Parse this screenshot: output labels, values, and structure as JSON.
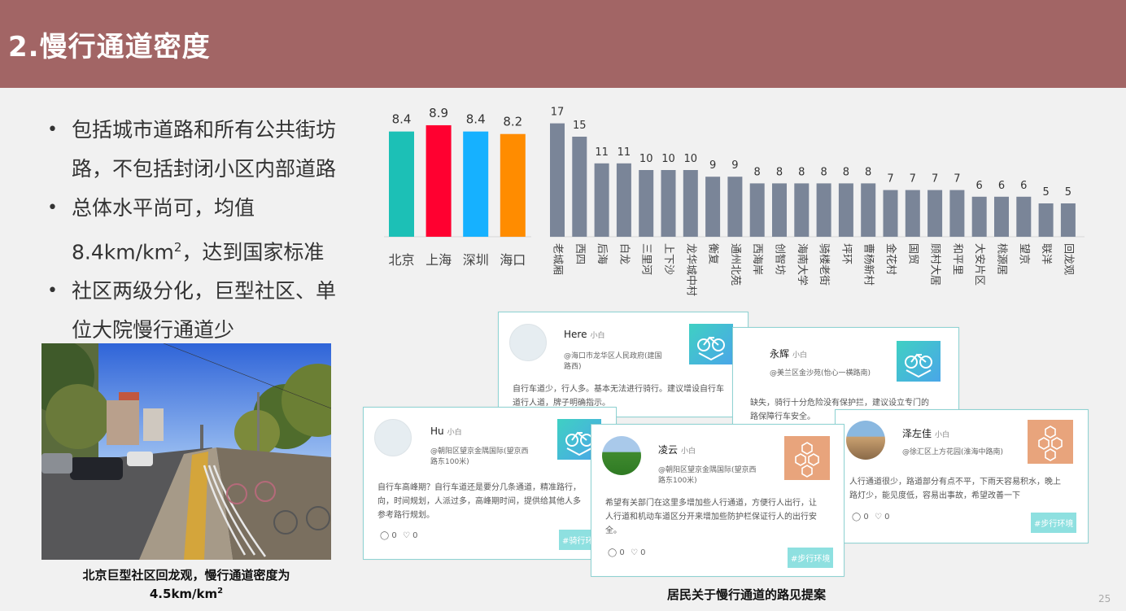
{
  "slide": {
    "title": "2.慢行通道密度",
    "bullets": [
      {
        "line1": "包括城市道路和所有公共街坊",
        "line2": "路，不包括封闭小区内部道路"
      },
      {
        "line1": "总体水平尚可，均值",
        "line2a": "8.4km/km",
        "line2sup": "2",
        "line2b": "，达到国家标准"
      },
      {
        "line1": "社区两级分化，巨型社区、单",
        "line2": "位大院慢行通道少"
      }
    ],
    "photo_caption": {
      "line1": "北京巨型社区回龙观，慢行通道密度为",
      "line2a": "4.5km/km",
      "line2sup": "2"
    },
    "cards_caption": "居民关于慢行通道的路见提案",
    "page_number": "25"
  },
  "chart_data": [
    {
      "type": "bar",
      "categories": [
        "北京",
        "上海",
        "深圳",
        "海口"
      ],
      "values": [
        8.4,
        8.9,
        8.4,
        8.2
      ],
      "colors": [
        "#1cc0b6",
        "#ff0030",
        "#16b1ff",
        "#ff8c00"
      ]
    },
    {
      "type": "bar",
      "categories": [
        "老城厢",
        "西四",
        "后海",
        "白龙",
        "三里河",
        "上下沙",
        "龙华城中村",
        "衡复",
        "通州北苑",
        "西海岸",
        "创智坊",
        "海南大学",
        "骑楼老街",
        "坪环",
        "曹杨新村",
        "金花村",
        "国贸",
        "顾村大居",
        "和平里",
        "大安片区",
        "桃源居",
        "望京",
        "联洋",
        "回龙观"
      ],
      "values": [
        17,
        15,
        11,
        11,
        10,
        10,
        10,
        9,
        9,
        8,
        8,
        8,
        8,
        8,
        8,
        7,
        7,
        7,
        7,
        6,
        6,
        6,
        5,
        5
      ],
      "colors": [
        "#7a8598"
      ]
    }
  ],
  "cards": [
    {
      "id": "here",
      "name": "Here",
      "tag": "小白",
      "location": [
        "@海口市龙华区人民政府(建国",
        "路西)"
      ],
      "body": [
        "自行车道少，行人多。基本无法进行骑行。建议增设自行车",
        "道行人道，牌子明确指示。"
      ],
      "badge": "bike",
      "avatar": "plain",
      "likes": "",
      "comments": "",
      "topic": ""
    },
    {
      "id": "yonghui",
      "name": "永辉",
      "tag": "小白",
      "location": [
        "@美兰区金沙苑(怡心一横路南)"
      ],
      "body": [
        "缺失，骑行十分危险没有保护拦，建议设立专门的",
        "路保障行车安全。"
      ],
      "badge": "bike",
      "avatar": "none",
      "likes": "",
      "comments": "",
      "topic": ""
    },
    {
      "id": "hu",
      "name": "Hu",
      "tag": "小白",
      "location": [
        "@朝阳区望京金隅国际(望京西",
        "路东100米)"
      ],
      "body": [
        "自行车高峰期？自行车道还是要分几条通道，精准路行，",
        "向，时间规划，人派过多，高峰期时间，提供给其他人多",
        "参考路行规划。"
      ],
      "badge": "bike",
      "avatar": "plain",
      "comments": "0",
      "likes": "0",
      "topic": "#骑行环"
    },
    {
      "id": "lingyun",
      "name": "凌云",
      "tag": "小白",
      "location": [
        "@朝阳区望京金隅国际(望京西",
        "路东100米)"
      ],
      "body": [
        "希望有关部门在这里多增加些人行通道，方便行人出行，让",
        "人行道和机动车道区分开来增加些防护栏保证行人的出行安",
        "全。"
      ],
      "badge": "hex",
      "avatar": "field",
      "comments": "0",
      "likes": "0",
      "topic": "#步行环境"
    },
    {
      "id": "zezuojia",
      "name": "泽左佳",
      "tag": "小白",
      "location": [
        "@徐汇区上方花园(淮海中路南)"
      ],
      "body": [
        "人行通道很少，路道部分有点不平，下雨天容易积水，晚上",
        "路灯少，能见度低，容易出事故，希望改善一下"
      ],
      "badge": "hex",
      "avatar": "city",
      "comments": "0",
      "likes": "0",
      "topic": "#步行环境"
    }
  ]
}
